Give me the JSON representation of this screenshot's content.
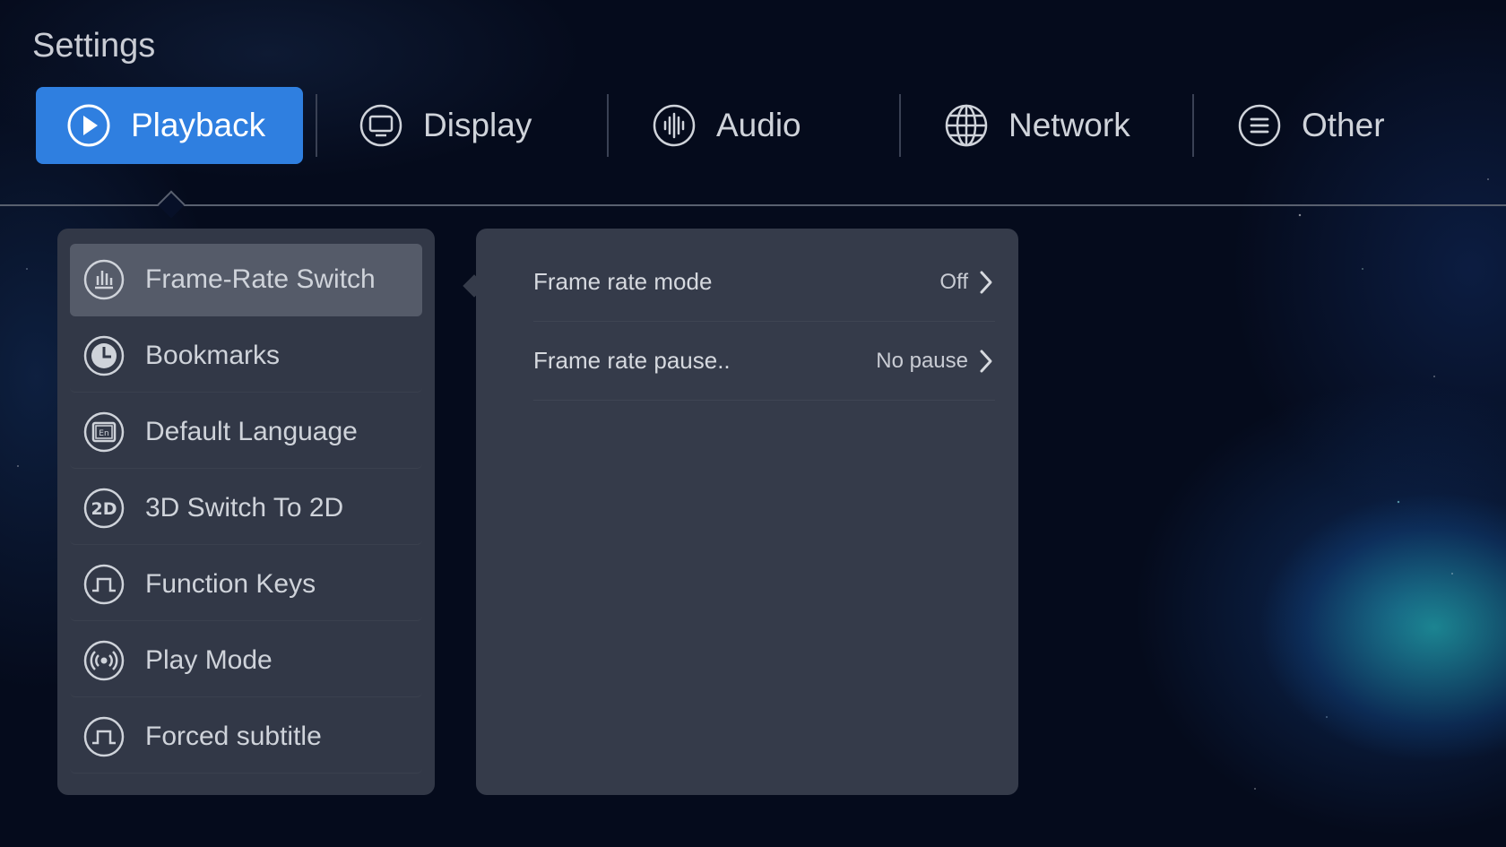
{
  "page_title": "Settings",
  "tabs": [
    {
      "label": "Playback",
      "icon": "play-icon",
      "active": true
    },
    {
      "label": "Display",
      "icon": "monitor-icon",
      "active": false
    },
    {
      "label": "Audio",
      "icon": "audio-wave-icon",
      "active": false
    },
    {
      "label": "Network",
      "icon": "globe-icon",
      "active": false
    },
    {
      "label": "Other",
      "icon": "list-icon",
      "active": false
    }
  ],
  "menu": {
    "items": [
      {
        "label": "Frame-Rate Switch",
        "icon": "bar-chart-icon",
        "active": true
      },
      {
        "label": "Bookmarks",
        "icon": "clock-icon",
        "active": false
      },
      {
        "label": "Default Language",
        "icon": "language-icon",
        "active": false
      },
      {
        "label": "3D Switch To 2D",
        "icon": "2d-icon",
        "active": false
      },
      {
        "label": "Function Keys",
        "icon": "pulse-icon",
        "active": false
      },
      {
        "label": "Play Mode",
        "icon": "broadcast-icon",
        "active": false
      },
      {
        "label": "Forced subtitle",
        "icon": "pulse-icon",
        "active": false
      }
    ]
  },
  "detail": {
    "rows": [
      {
        "label": "Frame rate mode",
        "value": "Off"
      },
      {
        "label": "Frame rate pause..",
        "value": "No pause"
      }
    ]
  },
  "colors": {
    "accent": "#2f7fe0",
    "panel": "#323847",
    "background": "#050b1c"
  }
}
